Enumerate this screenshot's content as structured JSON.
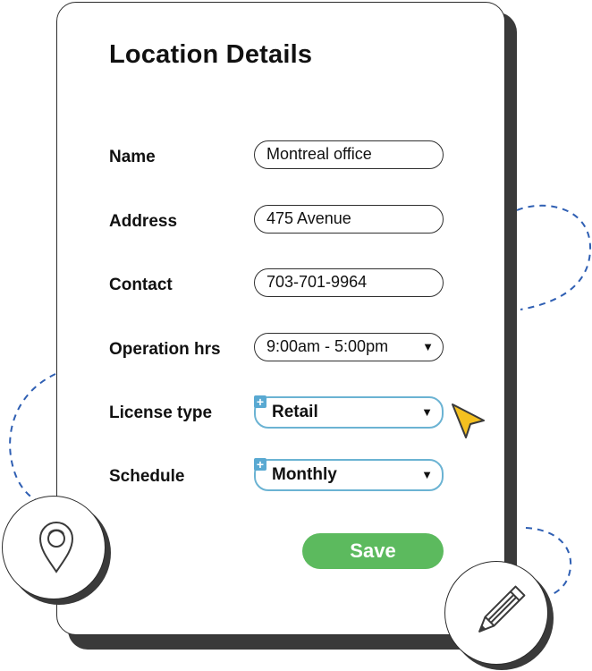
{
  "form": {
    "title": "Location Details",
    "fields": [
      {
        "label": "Name",
        "value": "Montreal office"
      },
      {
        "label": "Address",
        "value": "475 Avenue"
      },
      {
        "label": "Contact",
        "value": "703-701-9964"
      }
    ],
    "selects": [
      {
        "label": "Operation hrs",
        "value": "9:00am - 5:00pm"
      },
      {
        "label": "License type",
        "value": "Retail"
      },
      {
        "label": "Schedule",
        "value": "Monthly"
      }
    ],
    "save_label": "Save"
  },
  "icons": [
    "location-pin-icon",
    "pencil-icon",
    "cursor-icon",
    "plus-icon",
    "chevron-down-icon"
  ],
  "colors": {
    "accent_green": "#5cba5e",
    "accent_blue": "#6bb3d3",
    "cursor_yellow": "#f4c020"
  }
}
